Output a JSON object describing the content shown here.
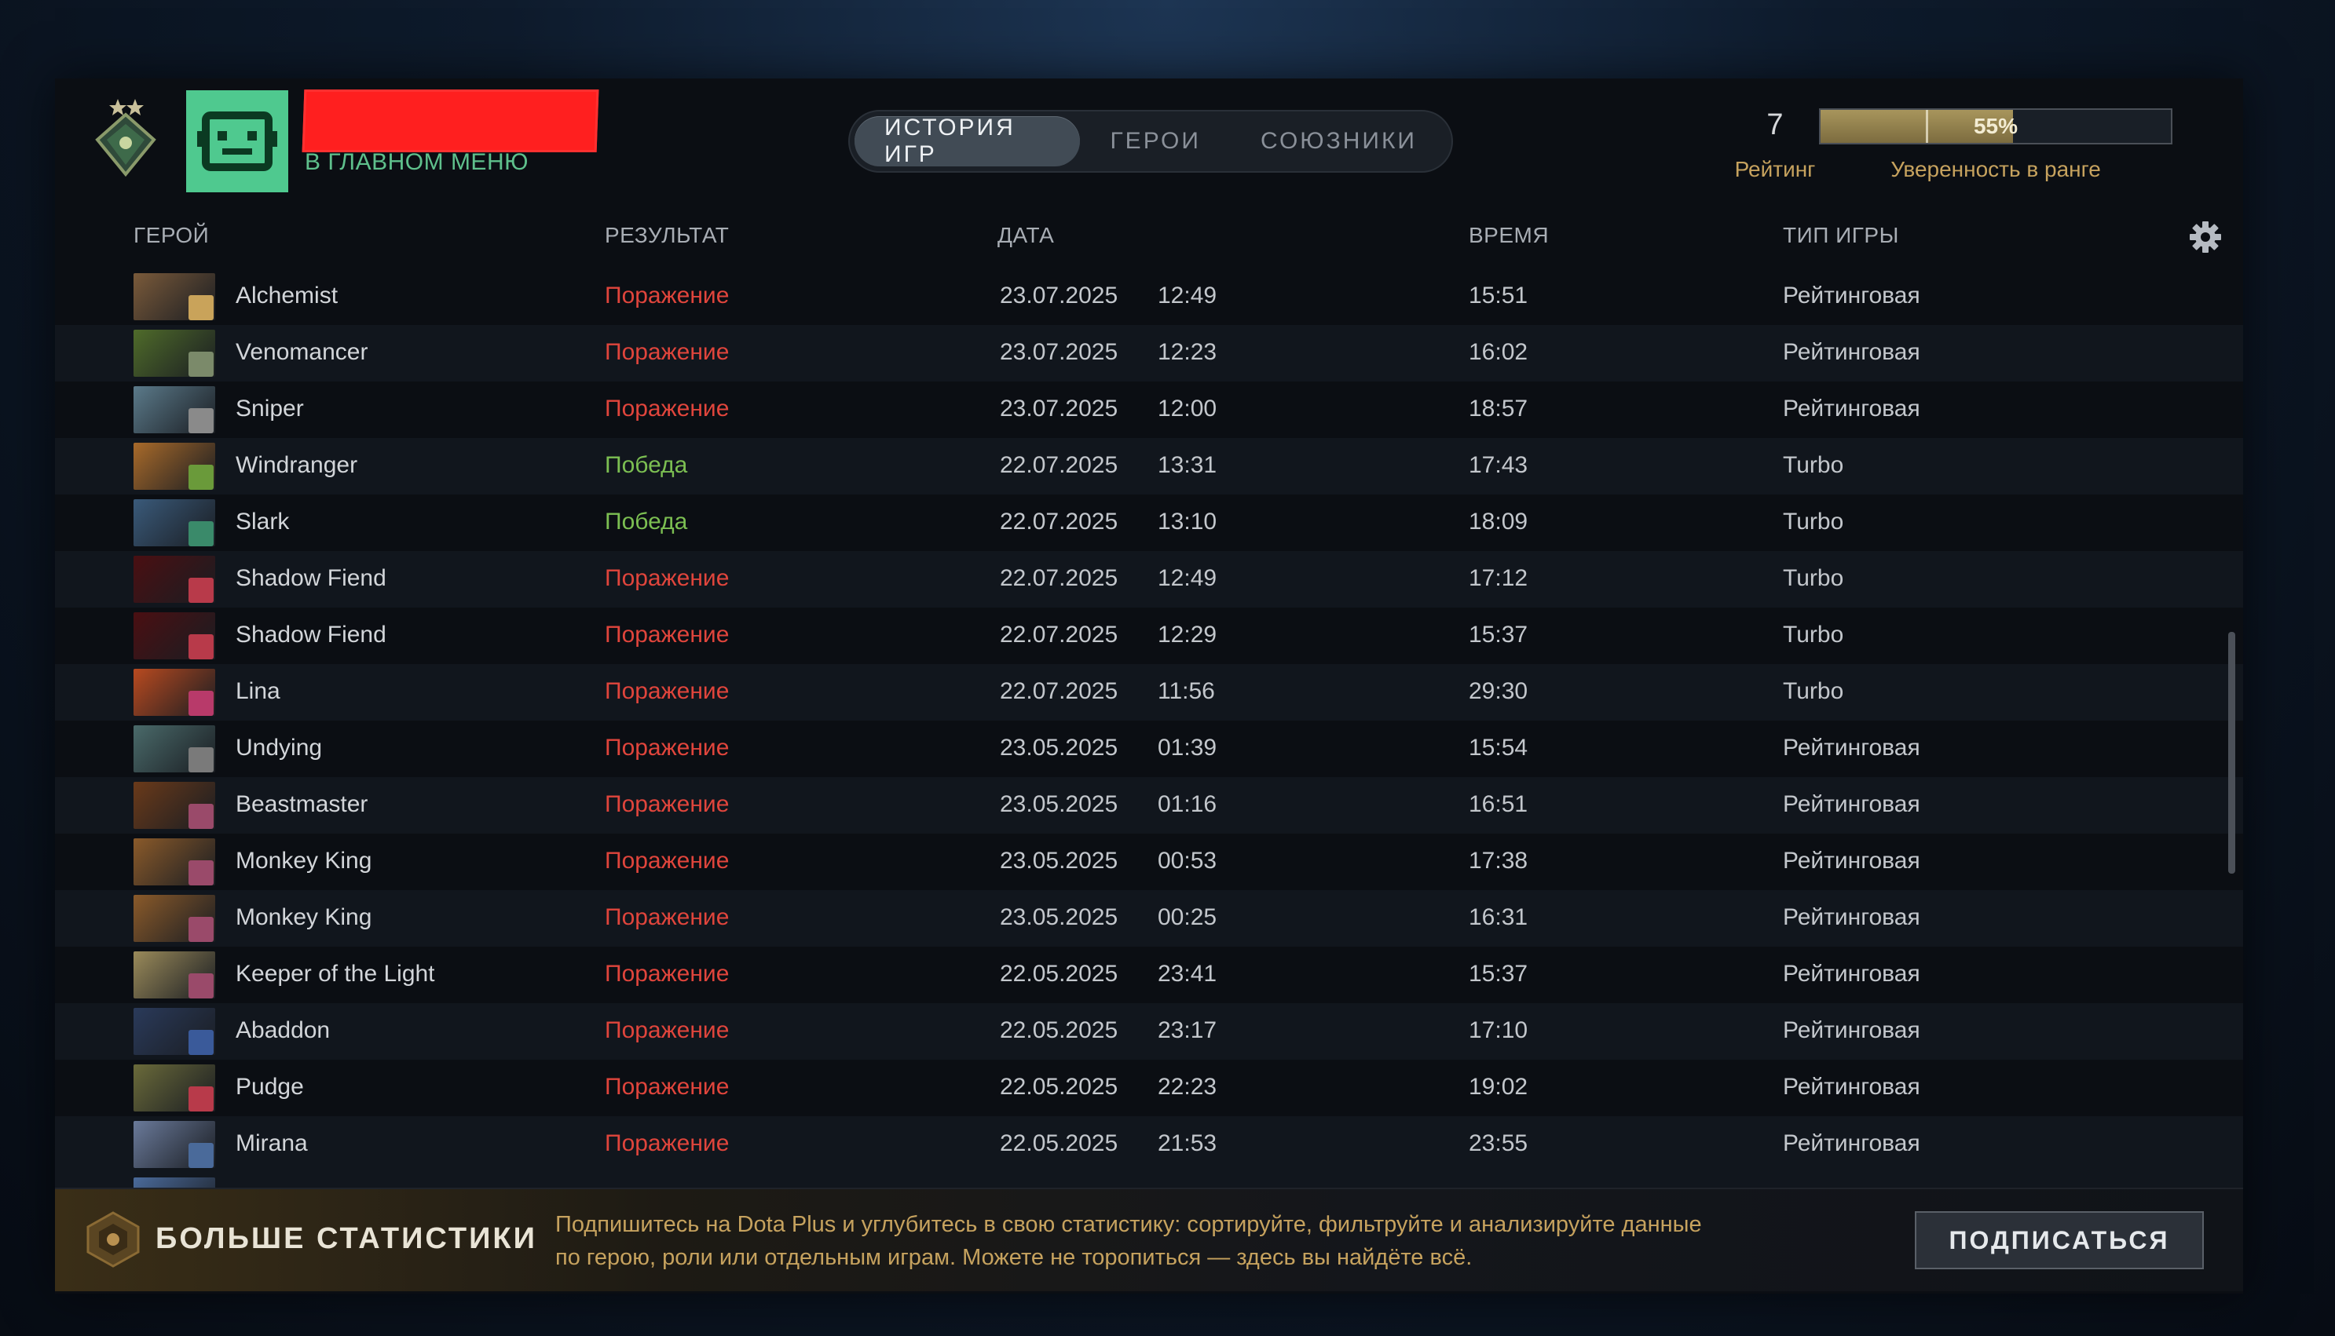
{
  "profile": {
    "status": "В ГЛАВНОМ МЕНЮ"
  },
  "tabs": [
    {
      "label": "ИСТОРИЯ ИГР",
      "active": true
    },
    {
      "label": "ГЕРОИ",
      "active": false
    },
    {
      "label": "СОЮЗНИКИ",
      "active": false
    }
  ],
  "rating": {
    "value": "7",
    "label": "Рейтинг"
  },
  "confidence": {
    "percent_text": "55%",
    "fraction": 0.55,
    "label": "Уверенность в ранге"
  },
  "table": {
    "headers": {
      "hero": "ГЕРОЙ",
      "result": "РЕЗУЛЬТАТ",
      "date": "ДАТА",
      "duration": "ВРЕМЯ",
      "game_type": "ТИП ИГРЫ"
    },
    "rows": [
      {
        "hero": "Alchemist",
        "result": "Поражение",
        "win": false,
        "date": "23.07.2025",
        "time": "12:49",
        "duration": "15:51",
        "type": "Рейтинговая",
        "color": "#7a5a3a",
        "role_color": "#c9a35a"
      },
      {
        "hero": "Venomancer",
        "result": "Поражение",
        "win": false,
        "date": "23.07.2025",
        "time": "12:23",
        "duration": "16:02",
        "type": "Рейтинговая",
        "color": "#4f6b2a",
        "role_color": "#7b8a6a"
      },
      {
        "hero": "Sniper",
        "result": "Поражение",
        "win": false,
        "date": "23.07.2025",
        "time": "12:00",
        "duration": "18:57",
        "type": "Рейтинговая",
        "color": "#5b7a8a",
        "role_color": "#8a8a8a"
      },
      {
        "hero": "Windranger",
        "result": "Победа",
        "win": true,
        "date": "22.07.2025",
        "time": "13:31",
        "duration": "17:43",
        "type": "Turbo",
        "color": "#a86a2a",
        "role_color": "#6a9a3a"
      },
      {
        "hero": "Slark",
        "result": "Победа",
        "win": true,
        "date": "22.07.2025",
        "time": "13:10",
        "duration": "18:09",
        "type": "Turbo",
        "color": "#3a5a7a",
        "role_color": "#3a8a6a"
      },
      {
        "hero": "Shadow Fiend",
        "result": "Поражение",
        "win": false,
        "date": "22.07.2025",
        "time": "12:49",
        "duration": "17:12",
        "type": "Turbo",
        "color": "#4a0f12",
        "role_color": "#b83a4a"
      },
      {
        "hero": "Shadow Fiend",
        "result": "Поражение",
        "win": false,
        "date": "22.07.2025",
        "time": "12:29",
        "duration": "15:37",
        "type": "Turbo",
        "color": "#4a0f12",
        "role_color": "#b83a4a"
      },
      {
        "hero": "Lina",
        "result": "Поражение",
        "win": false,
        "date": "22.07.2025",
        "time": "11:56",
        "duration": "29:30",
        "type": "Turbo",
        "color": "#b84a20",
        "role_color": "#b83a6a"
      },
      {
        "hero": "Undying",
        "result": "Поражение",
        "win": false,
        "date": "23.05.2025",
        "time": "01:39",
        "duration": "15:54",
        "type": "Рейтинговая",
        "color": "#4a6a6a",
        "role_color": "#7a7a7a"
      },
      {
        "hero": "Beastmaster",
        "result": "Поражение",
        "win": false,
        "date": "23.05.2025",
        "time": "01:16",
        "duration": "16:51",
        "type": "Рейтинговая",
        "color": "#6a3a1a",
        "role_color": "#9a4a6a"
      },
      {
        "hero": "Monkey King",
        "result": "Поражение",
        "win": false,
        "date": "23.05.2025",
        "time": "00:53",
        "duration": "17:38",
        "type": "Рейтинговая",
        "color": "#8a5a2a",
        "role_color": "#9a4a6a"
      },
      {
        "hero": "Monkey King",
        "result": "Поражение",
        "win": false,
        "date": "23.05.2025",
        "time": "00:25",
        "duration": "16:31",
        "type": "Рейтинговая",
        "color": "#8a5a2a",
        "role_color": "#9a4a6a"
      },
      {
        "hero": "Keeper of the Light",
        "result": "Поражение",
        "win": false,
        "date": "22.05.2025",
        "time": "23:41",
        "duration": "15:37",
        "type": "Рейтинговая",
        "color": "#9a8a5a",
        "role_color": "#9a4a6a"
      },
      {
        "hero": "Abaddon",
        "result": "Поражение",
        "win": false,
        "date": "22.05.2025",
        "time": "23:17",
        "duration": "17:10",
        "type": "Рейтинговая",
        "color": "#2a3a5a",
        "role_color": "#3a5a9a"
      },
      {
        "hero": "Pudge",
        "result": "Поражение",
        "win": false,
        "date": "22.05.2025",
        "time": "22:23",
        "duration": "19:02",
        "type": "Рейтинговая",
        "color": "#6a6a3a",
        "role_color": "#b83a4a"
      },
      {
        "hero": "Mirana",
        "result": "Поражение",
        "win": false,
        "date": "22.05.2025",
        "time": "21:53",
        "duration": "23:55",
        "type": "Рейтинговая",
        "color": "#6a7a9a",
        "role_color": "#4a6a9a"
      }
    ]
  },
  "banner": {
    "title": "БОЛЬШЕ СТАТИСТИКИ",
    "text_line1": "Подпишитесь на Dota Plus и углубитесь в свою статистику: сортируйте, фильтруйте и анализируйте данные",
    "text_line2": "по герою, роли или отдельным играм. Можете не торопиться — здесь вы найдёте всё.",
    "button": "ПОДПИСАТЬСЯ"
  },
  "icons": {
    "rank": "rank-medal-icon",
    "avatar": "avatar-icon",
    "settings": "gear-icon",
    "dota_plus": "dota-plus-icon"
  }
}
